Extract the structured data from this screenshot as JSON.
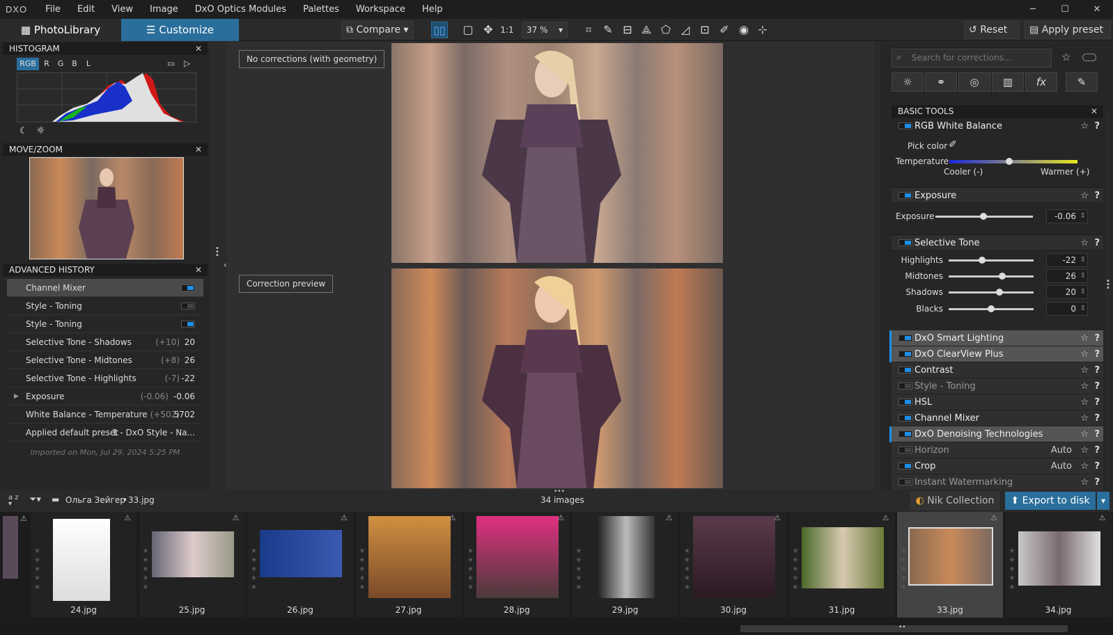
{
  "menu": {
    "logo": "DXO",
    "items": [
      "File",
      "Edit",
      "View",
      "Image",
      "DxO Optics Modules",
      "Palettes",
      "Workspace",
      "Help"
    ]
  },
  "window": {
    "minimize": "─",
    "maximize": "☐",
    "close": "✕"
  },
  "toolbar": {
    "tab_library": "PhotoLibrary",
    "tab_customize": "Customize",
    "compare": "Compare",
    "zoom_11": "1:1",
    "zoom": "37 %",
    "reset": "Reset",
    "apply_preset": "Apply preset"
  },
  "histogram": {
    "title": "HISTOGRAM",
    "channels": [
      "RGB",
      "R",
      "G",
      "B",
      "L"
    ]
  },
  "movezoom": {
    "title": "MOVE/ZOOM"
  },
  "history": {
    "title": "ADVANCED HISTORY",
    "items": [
      {
        "label": "Channel Mixer",
        "delta": "",
        "value": ""
      },
      {
        "label": "Style - Toning",
        "delta": "",
        "value": ""
      },
      {
        "label": "Style - Toning",
        "delta": "",
        "value": ""
      },
      {
        "label": "Selective Tone - Shadows",
        "delta": "(+10)",
        "value": "20"
      },
      {
        "label": "Selective Tone - Midtones",
        "delta": "(+8)",
        "value": "26"
      },
      {
        "label": "Selective Tone - Highlights",
        "delta": "(-7)",
        "value": "-22"
      },
      {
        "label": "Exposure",
        "delta": "(-0.06)",
        "value": "-0.06"
      },
      {
        "label": "White Balance - Temperature",
        "delta": "(+502)",
        "value": "5702"
      },
      {
        "label": "Applied default preset",
        "delta": "",
        "value": "1 - DxO Style - Na..."
      }
    ],
    "imported": "Imported on Mon, Jul 29, 2024 5:25 PM"
  },
  "viewer": {
    "top_label": "No corrections (with geometry)",
    "bottom_label": "Correction preview"
  },
  "right": {
    "search_placeholder": "Search for corrections...",
    "panel_title": "BASIC TOOLS",
    "wb": {
      "name": "RGB White Balance",
      "pick": "Pick color",
      "temp": "Temperature",
      "cooler": "Cooler (-)",
      "warmer": "Warmer (+)",
      "level": 0.47
    },
    "exposure": {
      "name": "Exposure",
      "label": "Exposure",
      "value": "-0.06",
      "level": 0.49
    },
    "seltone": {
      "name": "Selective Tone",
      "rows": [
        {
          "label": "Highlights",
          "value": "-22",
          "level": 0.39
        },
        {
          "label": "Midtones",
          "value": "26",
          "level": 0.63
        },
        {
          "label": "Shadows",
          "value": "20",
          "level": 0.6
        },
        {
          "label": "Blacks",
          "value": "0",
          "level": 0.5
        }
      ]
    },
    "tools": [
      {
        "name": "DxO Smart Lighting",
        "auto": "",
        "hl": true,
        "dim": false
      },
      {
        "name": "DxO ClearView Plus",
        "auto": "",
        "hl": true,
        "dim": false
      },
      {
        "name": "Contrast",
        "auto": "",
        "hl": false,
        "dim": false
      },
      {
        "name": "Style - Toning",
        "auto": "",
        "hl": false,
        "dim": true
      },
      {
        "name": "HSL",
        "auto": "",
        "hl": false,
        "dim": false
      },
      {
        "name": "Channel Mixer",
        "auto": "",
        "hl": false,
        "dim": false
      },
      {
        "name": "DxO Denoising Technologies",
        "auto": "",
        "hl": true,
        "dim": false
      },
      {
        "name": "Horizon",
        "auto": "Auto",
        "hl": false,
        "dim": true
      },
      {
        "name": "Crop",
        "auto": "Auto",
        "hl": false,
        "dim": false
      },
      {
        "name": "Instant Watermarking",
        "auto": "",
        "hl": false,
        "dim": true
      }
    ]
  },
  "filmbar": {
    "sort": "a z",
    "folder": "Ольга Зейгер",
    "file": "33.jpg",
    "count": "34 images",
    "nik": "Nik Collection",
    "export": "Export to disk"
  },
  "thumbs": [
    "24.jpg",
    "25.jpg",
    "26.jpg",
    "27.jpg",
    "28.jpg",
    "29.jpg",
    "30.jpg",
    "31.jpg",
    "33.jpg",
    "34.jpg"
  ],
  "colors": {
    "accent": "#2a6e9c",
    "toggle_on": "#1e90e8"
  }
}
